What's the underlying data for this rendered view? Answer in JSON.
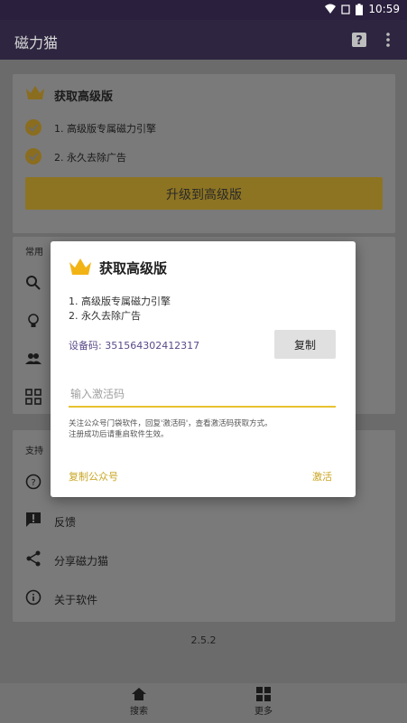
{
  "status_bar": {
    "time": "10:59"
  },
  "app_bar": {
    "title": "磁力猫",
    "help_icon": "help-icon",
    "more_icon": "more-vert-icon"
  },
  "background": {
    "premium_card": {
      "title": "获取高级版",
      "features": [
        "1. 高级版专属磁力引擎",
        "2. 永久去除广告"
      ],
      "upgrade_label": "升级到高级版"
    },
    "common_section": {
      "header": "常用"
    },
    "support_section": {
      "header": "支持",
      "items": [
        {
          "icon": "feedback-icon",
          "label": "反馈"
        },
        {
          "icon": "share-icon",
          "label": "分享磁力猫"
        },
        {
          "icon": "info-icon",
          "label": "关于软件"
        }
      ]
    },
    "version": "2.5.2"
  },
  "bottom_nav": {
    "items": [
      {
        "icon": "home-icon",
        "label": "搜索"
      },
      {
        "icon": "grid-icon",
        "label": "更多"
      }
    ]
  },
  "dialog": {
    "title": "获取高级版",
    "features": [
      "1. 高级版专属磁力引擎",
      "2. 永久去除广告"
    ],
    "device_code": "设备码: 351564302412317",
    "copy_label": "复制",
    "input_placeholder": "输入激活码",
    "hint_lines": [
      "关注公众号门袋软件，回复'激活码'，查看激活码获取方式。",
      "注册成功后请重启软件生效。"
    ],
    "copy_official_label": "复制公众号",
    "activate_label": "激活"
  },
  "colors": {
    "accent": "#c9a623",
    "app_bar": "#2e2640",
    "status_bar": "#2a1f3d"
  }
}
